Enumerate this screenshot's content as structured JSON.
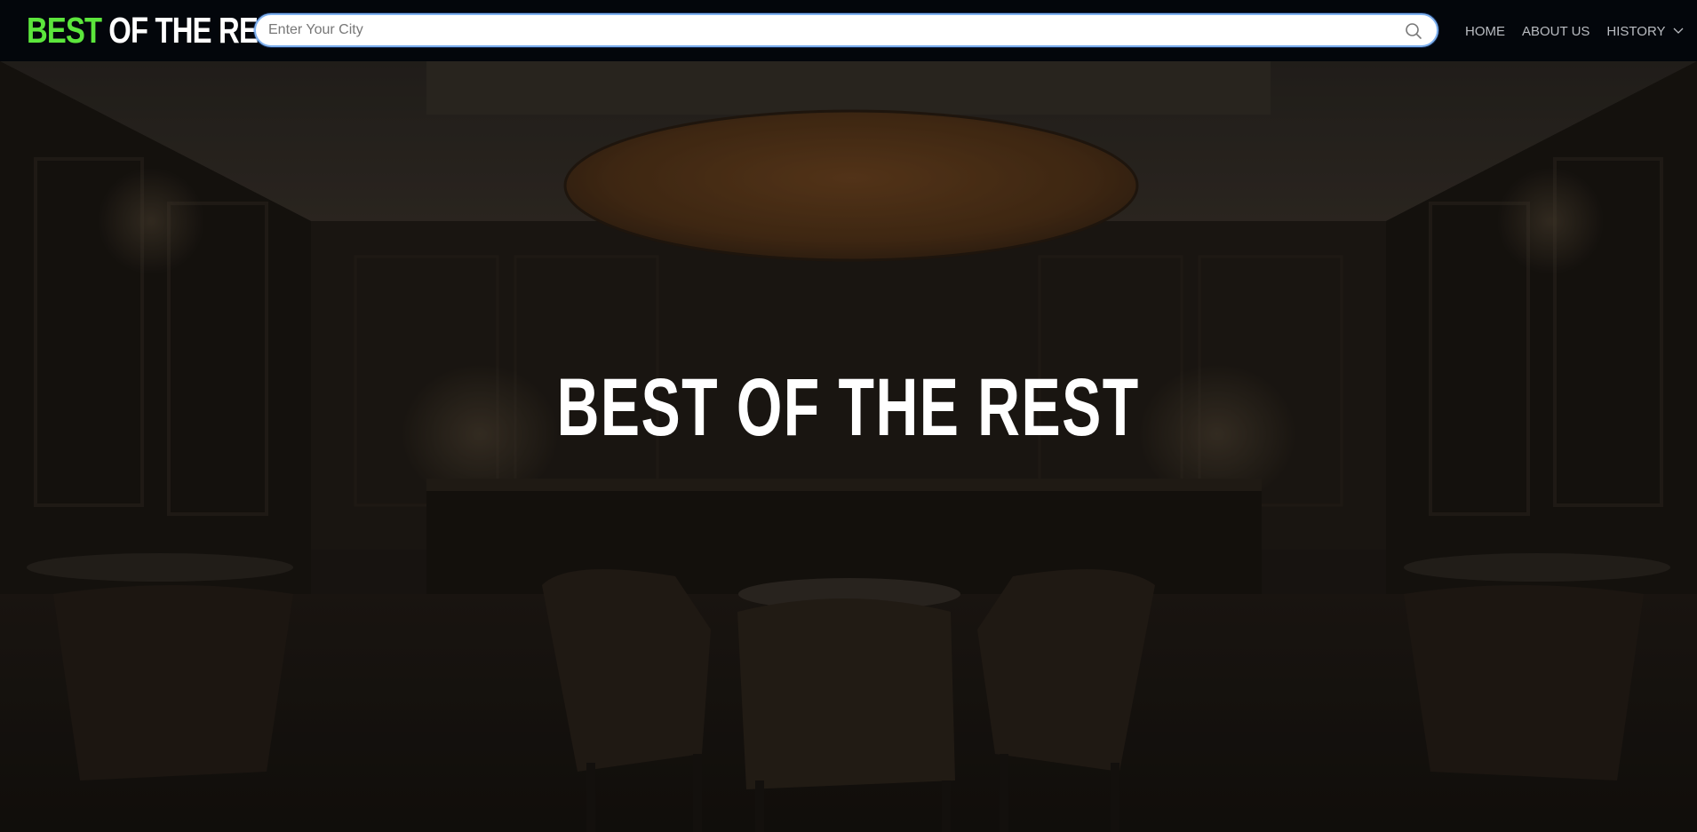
{
  "brand": {
    "accent": "BEST",
    "rest": "OF THE REST"
  },
  "search": {
    "placeholder": "Enter Your City",
    "icon": "search-icon"
  },
  "nav": {
    "items": [
      {
        "label": "HOME"
      },
      {
        "label": "ABOUT US"
      },
      {
        "label": "HISTORY",
        "icon": "chevron-down-icon"
      }
    ]
  },
  "hero": {
    "title": "BEST OF THE REST",
    "background": "dark restaurant dining room"
  },
  "colors": {
    "navbar": "#03060b",
    "brand_accent": "#5ce63c",
    "nav_text": "#b9bcc1",
    "search_border": "#7fb1ef"
  }
}
